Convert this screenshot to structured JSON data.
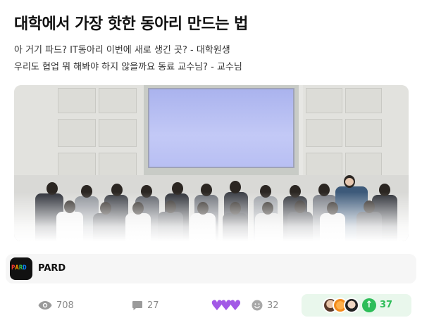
{
  "post": {
    "title": "대학에서 가장 핫한 동아리 만드는 법",
    "subtitle_1": "아 거기 파드? IT동아리 이번에 새로 생긴 곳? - 대학원생",
    "subtitle_2": "우리도 협업 뭐 해봐야 하지 않을까요 동료 교수님? - 교수님"
  },
  "source": {
    "name": "PARD",
    "logo_text": "PARD",
    "logo_colors": [
      "#ff3b30",
      "#ff9500",
      "#34c759",
      "#0a84ff"
    ]
  },
  "stats": {
    "views": "708",
    "comments": "27",
    "reactions": "32",
    "upvotes": "37"
  },
  "colors": {
    "heart": "#a259e6",
    "up_green": "#2ebd59",
    "up_bg": "#e9f7ec",
    "stat_gray": "#8a8a8a"
  },
  "icons": {
    "views": "eye-icon",
    "comments": "comment-icon",
    "hearts": "purple-heart-icon",
    "reactions": "smiley-icon",
    "upvote": "arrow-up-icon"
  }
}
